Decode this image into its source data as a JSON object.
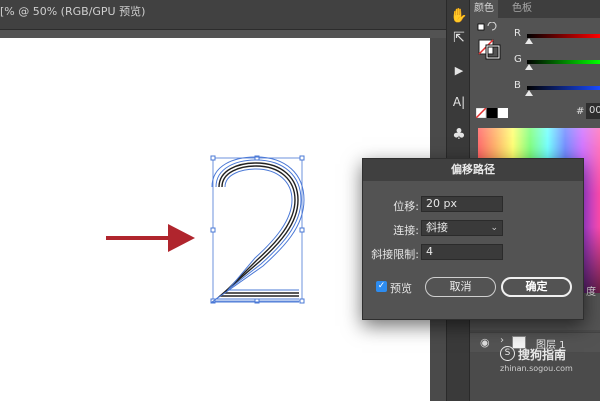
{
  "document": {
    "title": "[% @ 50% (RGB/GPU 预览)"
  },
  "tools": [
    {
      "icon": "puppet-warp-icon",
      "glyph": "✋"
    },
    {
      "icon": "export-icon",
      "glyph": "⇱"
    },
    {
      "icon": "play-action-icon",
      "glyph": "▶"
    },
    {
      "icon": "type-icon",
      "glyph": "A|"
    },
    {
      "icon": "club-symbol-icon",
      "glyph": "♣"
    }
  ],
  "panel": {
    "tabs": [
      {
        "label": "颜色",
        "active": true
      },
      {
        "label": "色板",
        "active": false
      }
    ],
    "channels": [
      {
        "label": "R"
      },
      {
        "label": "G"
      },
      {
        "label": "B"
      }
    ],
    "hex_prefix": "#",
    "hex_value": "00",
    "layer_name": "图层 1",
    "partial_label": "度"
  },
  "dialog": {
    "title": "偏移路径",
    "offset_label": "位移:",
    "offset_value": "20 px",
    "join_label": "连接:",
    "join_value": "斜接",
    "miter_label": "斜接限制:",
    "miter_value": "4",
    "preview_label": "预览",
    "preview_checked": true,
    "cancel_label": "取消",
    "ok_label": "确定"
  },
  "canvas": {
    "glyph": "2",
    "arrow_color": "#b0252d",
    "selection_color": "#4a78d6"
  },
  "watermark": {
    "main": "搜狗指南",
    "sub": "zhinan.sogou.com"
  }
}
